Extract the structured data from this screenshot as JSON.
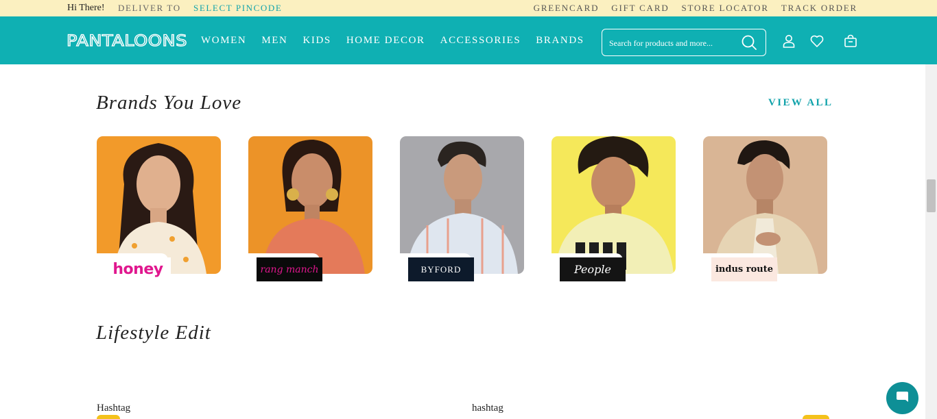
{
  "topbar": {
    "greeting": "Hi There!",
    "deliver_label": "DELIVER TO",
    "pincode_link": "SELECT PINCODE",
    "links": [
      "GREENCARD",
      "GIFT CARD",
      "STORE LOCATOR",
      "TRACK ORDER"
    ]
  },
  "header": {
    "logo_text": "PANTALOONS",
    "nav": [
      "WOMEN",
      "MEN",
      "KIDS",
      "HOME DECOR",
      "ACCESSORIES",
      "BRANDS"
    ],
    "search_placeholder": "Search for products and more...",
    "icons": [
      "search-icon",
      "user-icon",
      "heart-icon",
      "bag-icon"
    ],
    "brand_color": "#0fb0b3"
  },
  "brands_section": {
    "title": "Brands You Love",
    "view_all": "VIEW ALL",
    "brands": [
      {
        "name": "honey",
        "photo_bg": "#f29a2a"
      },
      {
        "name": "rang manch",
        "photo_bg": "#ec9328"
      },
      {
        "name": "BYFORD",
        "photo_bg": "#a8a8ac"
      },
      {
        "name": "People",
        "photo_bg": "#f5e85a"
      },
      {
        "name": "indus route",
        "photo_bg": "#d9b595"
      }
    ]
  },
  "lifestyle_section": {
    "title": "Lifestyle Edit",
    "items": [
      "Hashtag",
      "hashtag"
    ]
  },
  "chat": {
    "icon": "chat-icon",
    "color": "#0e8f96"
  },
  "accent_color": "#12a3ab"
}
